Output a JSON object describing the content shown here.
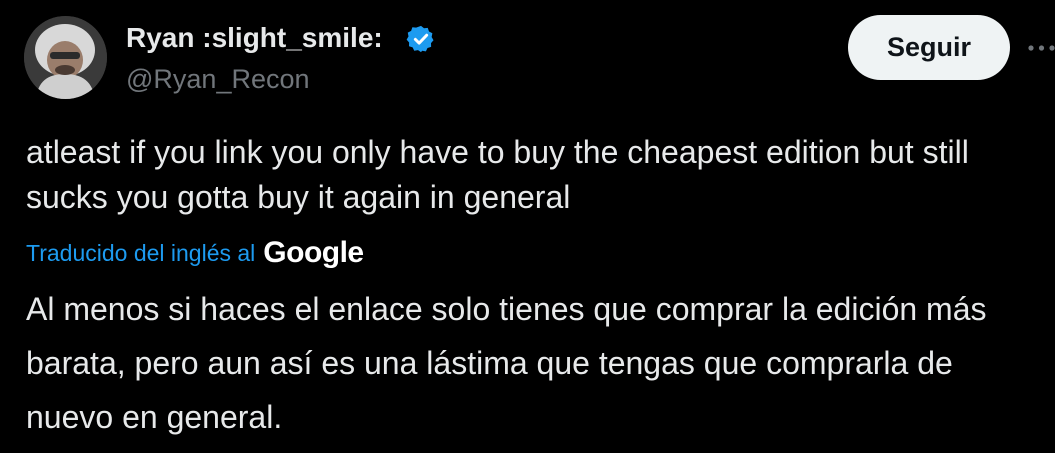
{
  "author": {
    "display_name": "Ryan :slight_smile:",
    "handle": "@Ryan_Recon",
    "verified": true,
    "avatar_icon": "user-avatar"
  },
  "actions": {
    "follow_label": "Seguir",
    "more_icon": "more-horizontal-icon"
  },
  "tweet": {
    "text": "atleast if you link you only have to buy the cheapest edition but still sucks you gotta buy it again in general"
  },
  "translation": {
    "label": "Traducido del inglés al",
    "provider": "Google",
    "text": "Al menos si haces el enlace solo tienes que comprar la edición más barata, pero aun así es una lástima que tengas que comprarla de nuevo en general."
  },
  "colors": {
    "background": "#000000",
    "text_primary": "#e7e9ea",
    "text_secondary": "#71767b",
    "accent": "#1d9bf0",
    "button_bg": "#eff3f4",
    "button_text": "#0f1419"
  }
}
